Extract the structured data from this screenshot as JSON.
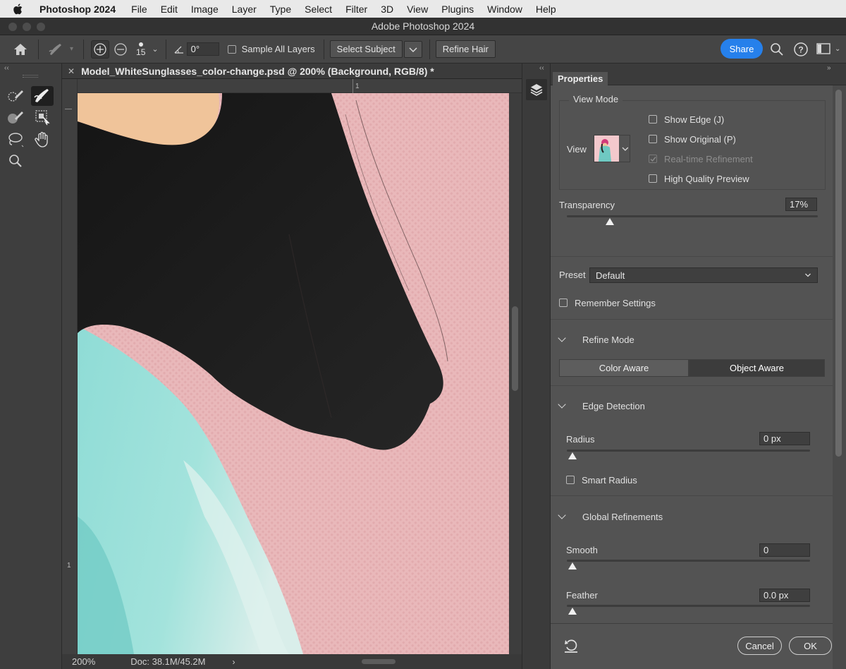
{
  "menubar": {
    "app_name": "Photoshop 2024",
    "items": [
      "File",
      "Edit",
      "Image",
      "Layer",
      "Type",
      "Select",
      "Filter",
      "3D",
      "View",
      "Plugins",
      "Window",
      "Help"
    ]
  },
  "window": {
    "title": "Adobe Photoshop 2024"
  },
  "options_bar": {
    "brush_size": "15",
    "angle_value": "0°",
    "sample_all_layers_label": "Sample All Layers",
    "select_subject_label": "Select Subject",
    "refine_hair_label": "Refine Hair",
    "share_label": "Share"
  },
  "document": {
    "tab_title": "Model_WhiteSunglasses_color-change.psd @ 200% (Background, RGB/8) *",
    "ruler_h_mark": "1",
    "ruler_v_mark": "1",
    "zoom": "200%",
    "doc_size": "Doc: 38.1M/45.2M"
  },
  "properties": {
    "tab_label": "Properties",
    "view_mode_label": "View Mode",
    "view_label": "View",
    "show_edge_label": "Show Edge (J)",
    "show_original_label": "Show Original (P)",
    "realtime_label": "Real-time Refinement",
    "hq_preview_label": "High Quality Preview",
    "transparency_label": "Transparency",
    "transparency_value": "17%",
    "transparency_fraction": 0.17,
    "preset_label": "Preset",
    "preset_value": "Default",
    "remember_label": "Remember Settings",
    "refine_mode_label": "Refine Mode",
    "color_aware_label": "Color Aware",
    "object_aware_label": "Object Aware",
    "edge_detection_label": "Edge Detection",
    "radius_label": "Radius",
    "radius_value": "0 px",
    "smart_radius_label": "Smart Radius",
    "global_refinements_label": "Global Refinements",
    "smooth_label": "Smooth",
    "smooth_value": "0",
    "feather_label": "Feather",
    "feather_value": "0.0 px",
    "cancel_label": "Cancel",
    "ok_label": "OK"
  },
  "colors": {
    "accent": "#2680eb",
    "background_pink": "#e7b4b6",
    "sweater": "#7fd5d0",
    "hair": "#1f1f1f"
  }
}
